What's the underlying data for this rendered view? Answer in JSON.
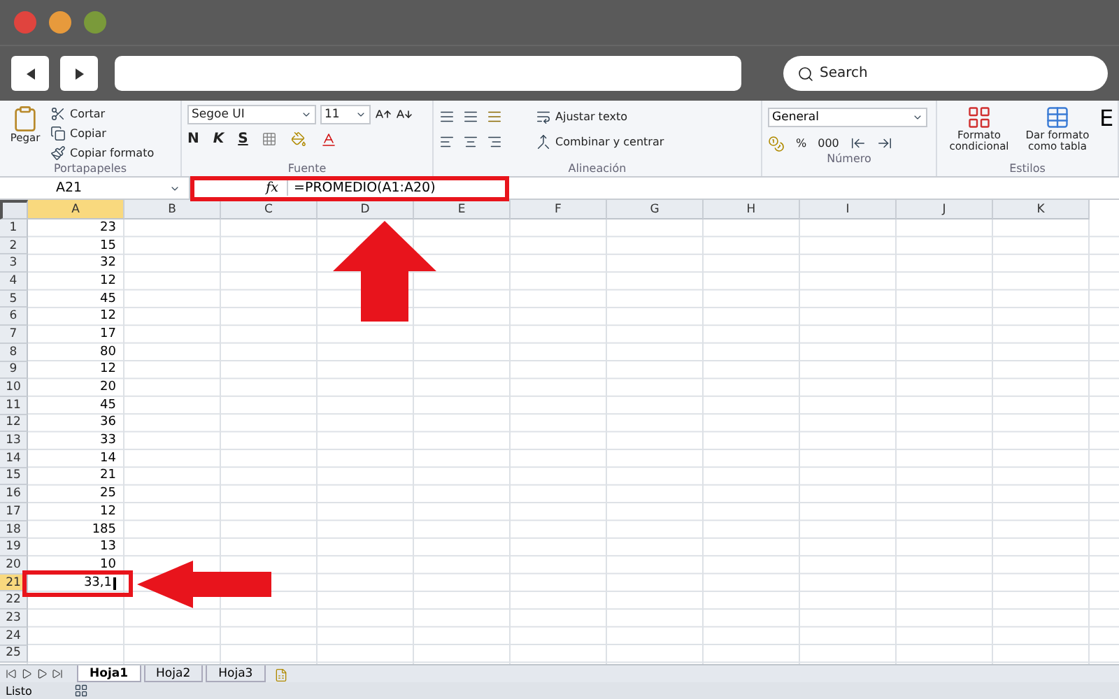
{
  "browser": {
    "search_placeholder": "Search"
  },
  "ribbon": {
    "groups": [
      {
        "kind": "clipboard",
        "label": "Portapapeles",
        "paste": "Pegar",
        "items": [
          "Cortar",
          "Copiar",
          "Copiar formato"
        ]
      },
      {
        "kind": "font",
        "label": "Fuente",
        "font": "Segoe UI",
        "size": "11",
        "bold": "N",
        "italic": "K",
        "underline": "S"
      },
      {
        "kind": "align",
        "label": "Alineación",
        "wrap": "Ajustar texto",
        "merge": "Combinar y centrar"
      },
      {
        "kind": "number",
        "label": "Número",
        "format": "General",
        "percent": "%",
        "thousands": "000"
      },
      {
        "kind": "styles",
        "label": "Estilos",
        "items": [
          "Formato condicional",
          "Dar formato como tabla"
        ],
        "cut": "E"
      }
    ]
  },
  "formula_bar": {
    "name_box": "A21",
    "fx": "fx",
    "formula": "=PROMEDIO(A1:A20)"
  },
  "columns": [
    {
      "label": "A",
      "selected": true
    },
    {
      "label": "B",
      "selected": false
    },
    {
      "label": "C",
      "selected": false
    },
    {
      "label": "D",
      "selected": false
    },
    {
      "label": "E",
      "selected": false
    },
    {
      "label": "F",
      "selected": false
    },
    {
      "label": "G",
      "selected": false
    },
    {
      "label": "H",
      "selected": false
    },
    {
      "label": "I",
      "selected": false
    },
    {
      "label": "J",
      "selected": false
    },
    {
      "label": "K",
      "selected": false
    }
  ],
  "rows": [
    {
      "n": "1",
      "a": "23",
      "selected": false
    },
    {
      "n": "2",
      "a": "15",
      "selected": false
    },
    {
      "n": "3",
      "a": "32",
      "selected": false
    },
    {
      "n": "4",
      "a": "12",
      "selected": false
    },
    {
      "n": "5",
      "a": "45",
      "selected": false
    },
    {
      "n": "6",
      "a": "12",
      "selected": false
    },
    {
      "n": "7",
      "a": "17",
      "selected": false
    },
    {
      "n": "8",
      "a": "80",
      "selected": false
    },
    {
      "n": "9",
      "a": "12",
      "selected": false
    },
    {
      "n": "10",
      "a": "20",
      "selected": false
    },
    {
      "n": "11",
      "a": "45",
      "selected": false
    },
    {
      "n": "12",
      "a": "36",
      "selected": false
    },
    {
      "n": "13",
      "a": "33",
      "selected": false
    },
    {
      "n": "14",
      "a": "14",
      "selected": false
    },
    {
      "n": "15",
      "a": "21",
      "selected": false
    },
    {
      "n": "16",
      "a": "25",
      "selected": false
    },
    {
      "n": "17",
      "a": "12",
      "selected": false
    },
    {
      "n": "18",
      "a": "185",
      "selected": false
    },
    {
      "n": "19",
      "a": "13",
      "selected": false
    },
    {
      "n": "20",
      "a": "10",
      "selected": false
    },
    {
      "n": "21",
      "a": "33,1",
      "selected": true
    },
    {
      "n": "22",
      "selected": false
    },
    {
      "n": "23",
      "selected": false
    },
    {
      "n": "24",
      "selected": false
    },
    {
      "n": "25",
      "selected": false
    }
  ],
  "sheet_tabs": [
    {
      "label": "Hoja1",
      "selected": true
    },
    {
      "label": "Hoja2",
      "selected": false
    },
    {
      "label": "Hoja3",
      "selected": false
    }
  ],
  "status_bar": {
    "text": "Listo"
  }
}
